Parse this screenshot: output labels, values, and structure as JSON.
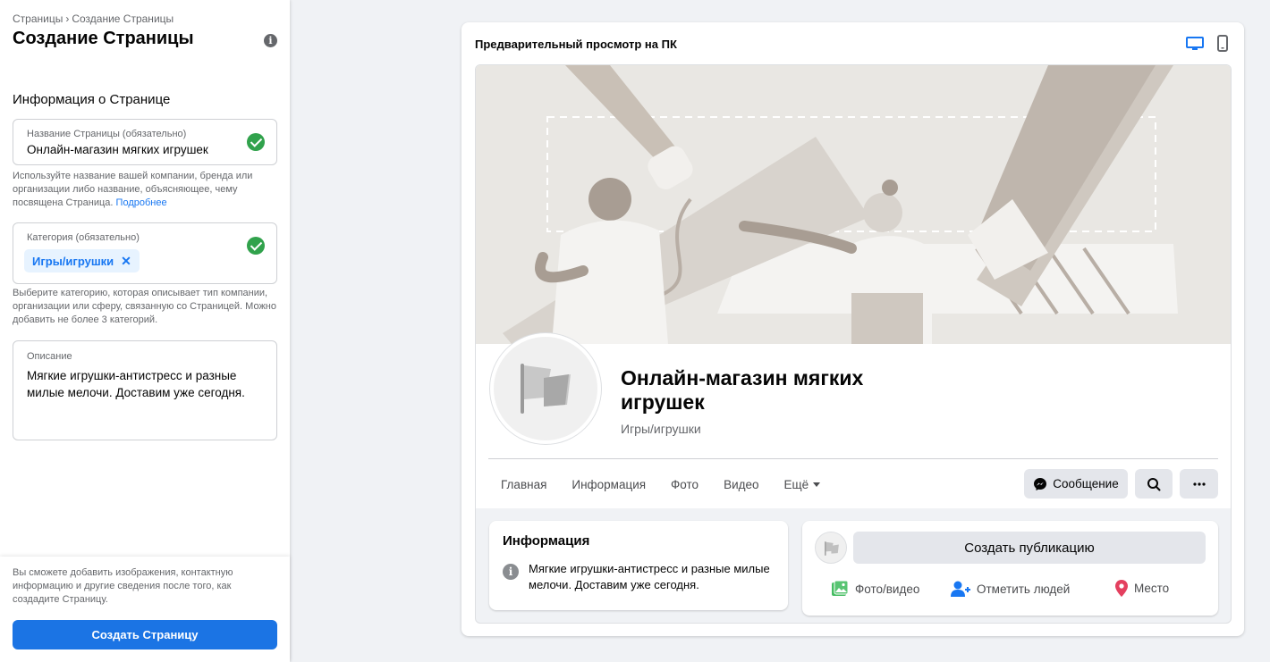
{
  "breadcrumb": {
    "parent": "Страницы",
    "separator": "›",
    "current": "Создание Страницы"
  },
  "sidebar": {
    "title": "Создание Страницы",
    "section_title": "Информация о Странице",
    "name_field": {
      "label": "Название Страницы (обязательно)",
      "value": "Онлайн-магазин мягких игрушек"
    },
    "name_help": "Используйте название вашей компании, бренда или организации либо название, объясняющее, чему посвящена Страница.",
    "name_help_link": "Подробнее",
    "category_field": {
      "label": "Категория (обязательно)",
      "chip": "Игры/игрушки",
      "chip_remove": "✕"
    },
    "category_help": "Выберите категорию, которая описывает тип компании, организации или сферу, связанную со Страницей. Можно добавить не более 3 категорий.",
    "description_field": {
      "label": "Описание",
      "value": "Мягкие игрушки-антистресс и разные милые мелочи. Доставим уже сегодня."
    },
    "bottom_note": "Вы сможете добавить изображения, контактную информацию и другие сведения после того, как создадите Страницу.",
    "create_button": "Создать Страницу"
  },
  "preview": {
    "title": "Предварительный просмотр на ПК",
    "page_name": "Онлайн-магазин мягких игрушек",
    "page_category": "Игры/игрушки",
    "tabs": [
      "Главная",
      "Информация",
      "Фото",
      "Видео",
      "Ещё"
    ],
    "message_button": "Сообщение",
    "info_card": {
      "title": "Информация",
      "text": "Мягкие игрушки-антистресс и разные милые мелочи. Доставим уже сегодня."
    },
    "post_card": {
      "create_post": "Создать публикацию",
      "photo_video": "Фото/видео",
      "tag_people": "Отметить людей",
      "place": "Место"
    }
  },
  "colors": {
    "accent": "#1b74e4",
    "check_green": "#31a24c",
    "chip_bg": "#e7f3ff",
    "place_red": "#e4405f"
  }
}
